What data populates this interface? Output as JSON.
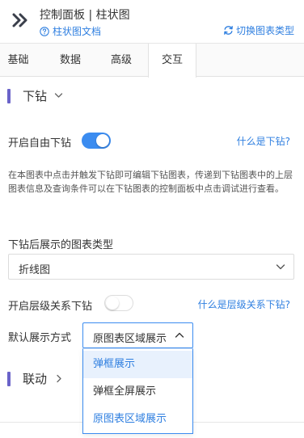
{
  "header": {
    "title": "控制面板 | 柱状图",
    "doc_link": "柱状图文档",
    "switch_link": "切换图表类型"
  },
  "tabs": [
    {
      "label": "基础"
    },
    {
      "label": "数据"
    },
    {
      "label": "高级"
    },
    {
      "label": "交互",
      "active": true
    }
  ],
  "drilldown": {
    "section_label": "下钻",
    "free_drill_label": "开启自由下钻",
    "free_drill_on": true,
    "free_drill_help": "什么是下钻?",
    "description": "在本图表中点击并触发下钻即可编辑下钻图表，传递到下钻图表中的上层图表信息及查询条件可以在下钻图表的控制面板中点击调试进行查看。",
    "chart_type_label": "下钻后展示的图表类型",
    "chart_type_value": "折线图",
    "hier_drill_label": "开启层级关系下钻",
    "hier_drill_on": false,
    "hier_drill_help": "什么是层级关系下钻?",
    "display_mode_label": "默认展示方式",
    "display_mode_value": "原图表区域展示",
    "display_mode_options": [
      {
        "label": "弹框展示"
      },
      {
        "label": "弹框全屏展示"
      },
      {
        "label": "原图表区域展示"
      }
    ]
  },
  "linkage": {
    "section_label": "联动"
  },
  "colors": {
    "accent": "#3b8cf0",
    "link": "#2f7fe0",
    "section_bar": "#6a63c9"
  }
}
